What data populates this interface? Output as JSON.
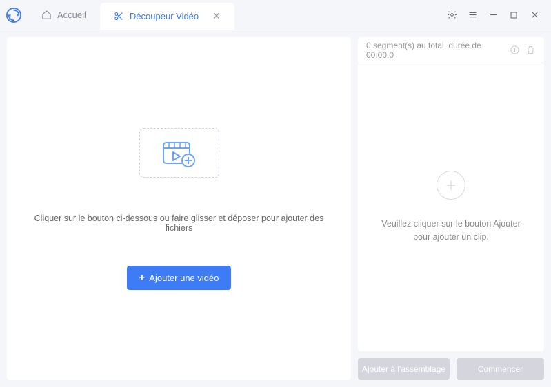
{
  "tabs": {
    "home_label": "Accueil",
    "active_label": "Découpeur Vidéo"
  },
  "main": {
    "instruction": "Cliquer sur le bouton ci-dessous ou faire glisser et déposer pour ajouter des fichiers",
    "add_video_label": "Ajouter une vidéo"
  },
  "segments": {
    "count_text": "0 segment(s) au total, durée de 00:00.0",
    "hint": "Veuillez cliquer sur le bouton Ajouter pour ajouter un clip."
  },
  "actions": {
    "add_assembly": "Ajouter à l'assemblage",
    "start": "Commencer"
  }
}
